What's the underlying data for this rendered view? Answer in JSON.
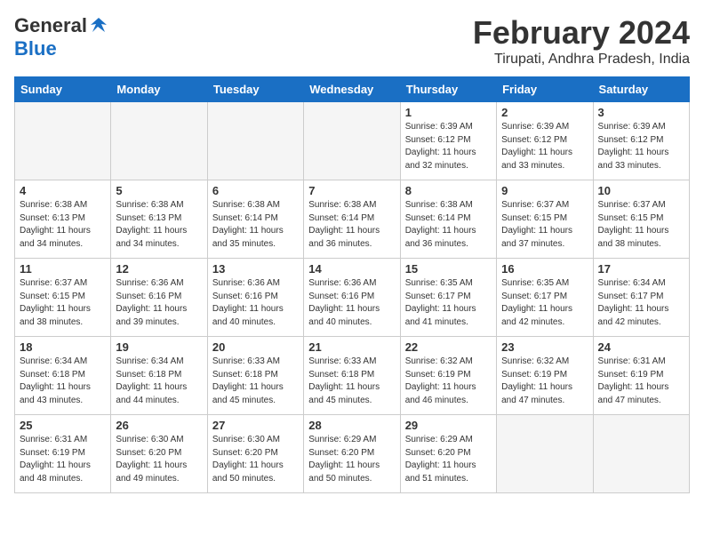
{
  "logo": {
    "general": "General",
    "blue": "Blue"
  },
  "header": {
    "month": "February 2024",
    "location": "Tirupati, Andhra Pradesh, India"
  },
  "weekdays": [
    "Sunday",
    "Monday",
    "Tuesday",
    "Wednesday",
    "Thursday",
    "Friday",
    "Saturday"
  ],
  "weeks": [
    [
      {
        "day": "",
        "empty": true
      },
      {
        "day": "",
        "empty": true
      },
      {
        "day": "",
        "empty": true
      },
      {
        "day": "",
        "empty": true
      },
      {
        "day": "1",
        "sunrise": "6:39 AM",
        "sunset": "6:12 PM",
        "daylight": "11 hours and 32 minutes."
      },
      {
        "day": "2",
        "sunrise": "6:39 AM",
        "sunset": "6:12 PM",
        "daylight": "11 hours and 33 minutes."
      },
      {
        "day": "3",
        "sunrise": "6:39 AM",
        "sunset": "6:12 PM",
        "daylight": "11 hours and 33 minutes."
      }
    ],
    [
      {
        "day": "4",
        "sunrise": "6:38 AM",
        "sunset": "6:13 PM",
        "daylight": "11 hours and 34 minutes."
      },
      {
        "day": "5",
        "sunrise": "6:38 AM",
        "sunset": "6:13 PM",
        "daylight": "11 hours and 34 minutes."
      },
      {
        "day": "6",
        "sunrise": "6:38 AM",
        "sunset": "6:14 PM",
        "daylight": "11 hours and 35 minutes."
      },
      {
        "day": "7",
        "sunrise": "6:38 AM",
        "sunset": "6:14 PM",
        "daylight": "11 hours and 36 minutes."
      },
      {
        "day": "8",
        "sunrise": "6:38 AM",
        "sunset": "6:14 PM",
        "daylight": "11 hours and 36 minutes."
      },
      {
        "day": "9",
        "sunrise": "6:37 AM",
        "sunset": "6:15 PM",
        "daylight": "11 hours and 37 minutes."
      },
      {
        "day": "10",
        "sunrise": "6:37 AM",
        "sunset": "6:15 PM",
        "daylight": "11 hours and 38 minutes."
      }
    ],
    [
      {
        "day": "11",
        "sunrise": "6:37 AM",
        "sunset": "6:15 PM",
        "daylight": "11 hours and 38 minutes."
      },
      {
        "day": "12",
        "sunrise": "6:36 AM",
        "sunset": "6:16 PM",
        "daylight": "11 hours and 39 minutes."
      },
      {
        "day": "13",
        "sunrise": "6:36 AM",
        "sunset": "6:16 PM",
        "daylight": "11 hours and 40 minutes."
      },
      {
        "day": "14",
        "sunrise": "6:36 AM",
        "sunset": "6:16 PM",
        "daylight": "11 hours and 40 minutes."
      },
      {
        "day": "15",
        "sunrise": "6:35 AM",
        "sunset": "6:17 PM",
        "daylight": "11 hours and 41 minutes."
      },
      {
        "day": "16",
        "sunrise": "6:35 AM",
        "sunset": "6:17 PM",
        "daylight": "11 hours and 42 minutes."
      },
      {
        "day": "17",
        "sunrise": "6:34 AM",
        "sunset": "6:17 PM",
        "daylight": "11 hours and 42 minutes."
      }
    ],
    [
      {
        "day": "18",
        "sunrise": "6:34 AM",
        "sunset": "6:18 PM",
        "daylight": "11 hours and 43 minutes."
      },
      {
        "day": "19",
        "sunrise": "6:34 AM",
        "sunset": "6:18 PM",
        "daylight": "11 hours and 44 minutes."
      },
      {
        "day": "20",
        "sunrise": "6:33 AM",
        "sunset": "6:18 PM",
        "daylight": "11 hours and 45 minutes."
      },
      {
        "day": "21",
        "sunrise": "6:33 AM",
        "sunset": "6:18 PM",
        "daylight": "11 hours and 45 minutes."
      },
      {
        "day": "22",
        "sunrise": "6:32 AM",
        "sunset": "6:19 PM",
        "daylight": "11 hours and 46 minutes."
      },
      {
        "day": "23",
        "sunrise": "6:32 AM",
        "sunset": "6:19 PM",
        "daylight": "11 hours and 47 minutes."
      },
      {
        "day": "24",
        "sunrise": "6:31 AM",
        "sunset": "6:19 PM",
        "daylight": "11 hours and 47 minutes."
      }
    ],
    [
      {
        "day": "25",
        "sunrise": "6:31 AM",
        "sunset": "6:19 PM",
        "daylight": "11 hours and 48 minutes."
      },
      {
        "day": "26",
        "sunrise": "6:30 AM",
        "sunset": "6:20 PM",
        "daylight": "11 hours and 49 minutes."
      },
      {
        "day": "27",
        "sunrise": "6:30 AM",
        "sunset": "6:20 PM",
        "daylight": "11 hours and 50 minutes."
      },
      {
        "day": "28",
        "sunrise": "6:29 AM",
        "sunset": "6:20 PM",
        "daylight": "11 hours and 50 minutes."
      },
      {
        "day": "29",
        "sunrise": "6:29 AM",
        "sunset": "6:20 PM",
        "daylight": "11 hours and 51 minutes."
      },
      {
        "day": "",
        "empty": true
      },
      {
        "day": "",
        "empty": true
      }
    ]
  ]
}
